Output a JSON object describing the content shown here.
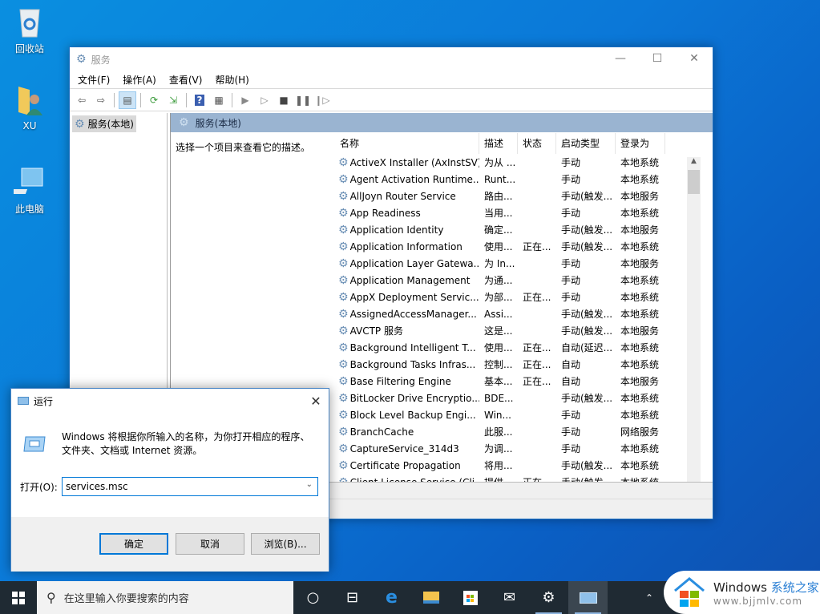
{
  "desktop": {
    "icons": [
      {
        "label": "回收站",
        "icon": "recycle-bin-icon"
      },
      {
        "label": "XU",
        "icon": "user-folder-icon"
      },
      {
        "label": "此电脑",
        "icon": "this-pc-icon"
      }
    ]
  },
  "services_window": {
    "title": "服务",
    "menu": [
      "文件(F)",
      "操作(A)",
      "查看(V)",
      "帮助(H)"
    ],
    "toolbar": [
      "back-icon",
      "forward-icon",
      "show-hide-tree-icon",
      "refresh-icon",
      "export-icon",
      "help-icon",
      "properties-icon",
      "start-icon",
      "start-alt-icon",
      "stop-icon",
      "pause-icon",
      "restart-icon"
    ],
    "tree_node": "服务(本地)",
    "pane_header": "服务(本地)",
    "description_hint": "选择一个项目来查看它的描述。",
    "columns": [
      "名称",
      "描述",
      "状态",
      "启动类型",
      "登录为"
    ],
    "rows": [
      {
        "name": "ActiveX Installer (AxInstSV)",
        "desc": "为从 ...",
        "status": "",
        "startup": "手动",
        "logon": "本地系统"
      },
      {
        "name": "Agent Activation Runtime...",
        "desc": "Runt...",
        "status": "",
        "startup": "手动",
        "logon": "本地系统"
      },
      {
        "name": "AllJoyn Router Service",
        "desc": "路由...",
        "status": "",
        "startup": "手动(触发...",
        "logon": "本地服务"
      },
      {
        "name": "App Readiness",
        "desc": "当用...",
        "status": "",
        "startup": "手动",
        "logon": "本地系统"
      },
      {
        "name": "Application Identity",
        "desc": "确定...",
        "status": "",
        "startup": "手动(触发...",
        "logon": "本地服务"
      },
      {
        "name": "Application Information",
        "desc": "使用...",
        "status": "正在...",
        "startup": "手动(触发...",
        "logon": "本地系统"
      },
      {
        "name": "Application Layer Gatewa...",
        "desc": "为 In...",
        "status": "",
        "startup": "手动",
        "logon": "本地服务"
      },
      {
        "name": "Application Management",
        "desc": "为通...",
        "status": "",
        "startup": "手动",
        "logon": "本地系统"
      },
      {
        "name": "AppX Deployment Servic...",
        "desc": "为部...",
        "status": "正在...",
        "startup": "手动",
        "logon": "本地系统"
      },
      {
        "name": "AssignedAccessManager...",
        "desc": "Assi...",
        "status": "",
        "startup": "手动(触发...",
        "logon": "本地系统"
      },
      {
        "name": "AVCTP 服务",
        "desc": "这是...",
        "status": "",
        "startup": "手动(触发...",
        "logon": "本地服务"
      },
      {
        "name": "Background Intelligent T...",
        "desc": "使用...",
        "status": "正在...",
        "startup": "自动(延迟...",
        "logon": "本地系统"
      },
      {
        "name": "Background Tasks Infras...",
        "desc": "控制...",
        "status": "正在...",
        "startup": "自动",
        "logon": "本地系统"
      },
      {
        "name": "Base Filtering Engine",
        "desc": "基本...",
        "status": "正在...",
        "startup": "自动",
        "logon": "本地服务"
      },
      {
        "name": "BitLocker Drive Encryptio...",
        "desc": "BDE...",
        "status": "",
        "startup": "手动(触发...",
        "logon": "本地系统"
      },
      {
        "name": "Block Level Backup Engi...",
        "desc": "Win...",
        "status": "",
        "startup": "手动",
        "logon": "本地系统"
      },
      {
        "name": "BranchCache",
        "desc": "此服...",
        "status": "",
        "startup": "手动",
        "logon": "网络服务"
      },
      {
        "name": "CaptureService_314d3",
        "desc": "为调...",
        "status": "",
        "startup": "手动",
        "logon": "本地系统"
      },
      {
        "name": "Certificate Propagation",
        "desc": "将用...",
        "status": "",
        "startup": "手动(触发...",
        "logon": "本地系统"
      },
      {
        "name": "Client License Service (Cli...",
        "desc": "提供...",
        "status": "正在...",
        "startup": "手动(触发...",
        "logon": "本地系统"
      }
    ]
  },
  "run_dialog": {
    "title": "运行",
    "message": "Windows 将根据你所输入的名称，为你打开相应的程序、文件夹、文档或 Internet 资源。",
    "open_label": "打开(O):",
    "input_value": "services.msc",
    "ok": "确定",
    "cancel": "取消",
    "browse": "浏览(B)..."
  },
  "taskbar": {
    "search_placeholder": "在这里输入你要搜索的内容",
    "apps": [
      "cortana-icon",
      "task-view-icon",
      "edge-icon",
      "file-explorer-icon",
      "store-icon",
      "mail-icon",
      "services-icon",
      "run-icon"
    ]
  },
  "watermark": {
    "brand": "Windows",
    "brand_cn": "系统之家",
    "url": "www.bjjmlv.com"
  }
}
